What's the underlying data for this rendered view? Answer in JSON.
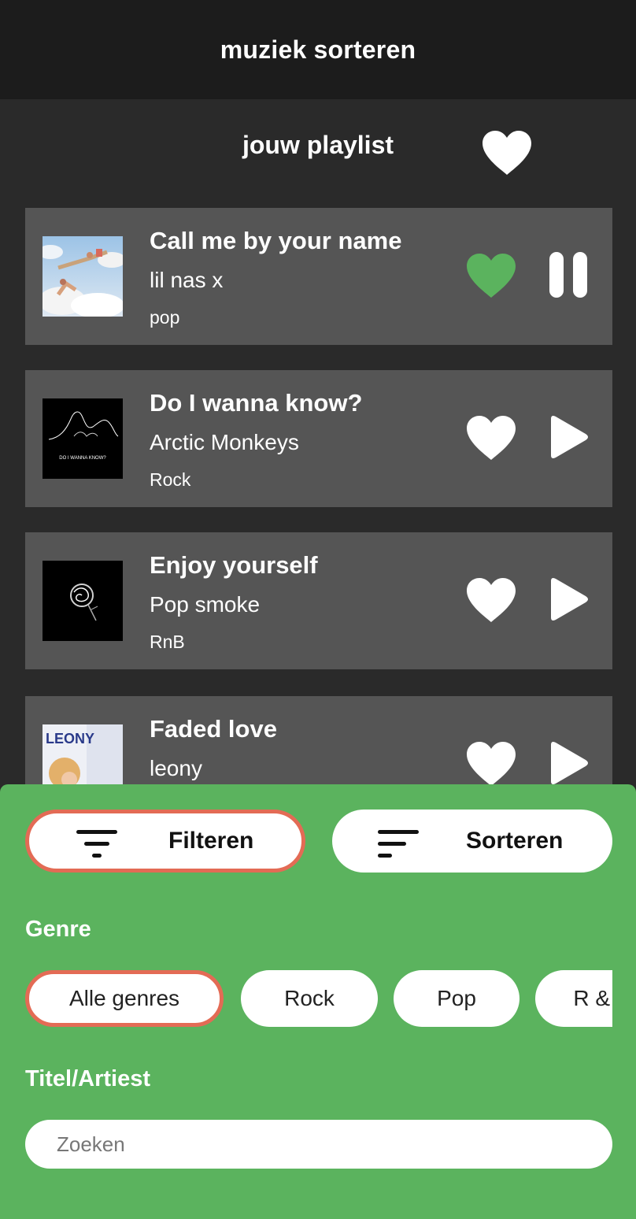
{
  "header": {
    "title": "muziek sorteren"
  },
  "playlist": {
    "title": "jouw playlist",
    "heart_icon": "heart-icon"
  },
  "songs": [
    {
      "title": "Call me by your name",
      "artist": "lil nas x",
      "genre": "pop",
      "liked": true,
      "state": "playing",
      "like_icon": "heart-icon",
      "action_icon": "pause-icon"
    },
    {
      "title": "Do I wanna know?",
      "artist": "Arctic Monkeys",
      "genre": "Rock",
      "liked": false,
      "state": "paused",
      "like_icon": "heart-icon",
      "action_icon": "play-icon",
      "cover_text": "DO I WANNA KNOW?"
    },
    {
      "title": "Enjoy yourself",
      "artist": "Pop smoke",
      "genre": "RnB",
      "liked": false,
      "state": "paused",
      "like_icon": "heart-icon",
      "action_icon": "play-icon"
    },
    {
      "title": "Faded love",
      "artist": "leony",
      "genre": "",
      "liked": false,
      "state": "paused",
      "like_icon": "heart-icon",
      "action_icon": "play-icon",
      "cover_text": "LEONY"
    }
  ],
  "controls": {
    "filter_label": "Filteren",
    "filter_icon": "filter-icon",
    "sort_label": "Sorteren",
    "sort_icon": "sort-icon",
    "active_tab": "filter"
  },
  "filter": {
    "genre_label": "Genre",
    "genres": [
      "Alle genres",
      "Rock",
      "Pop",
      "R & B"
    ],
    "selected_genre": "Alle genres",
    "search_label": "Titel/Artiest",
    "search_placeholder": "Zoeken",
    "search_value": ""
  },
  "colors": {
    "accent_green": "#5bb35e",
    "liked_heart": "#5bb35e",
    "active_outline": "#e36b55",
    "header_bg": "#1c1c1c",
    "page_bg": "#2a2a2a",
    "card_bg": "#555555"
  }
}
